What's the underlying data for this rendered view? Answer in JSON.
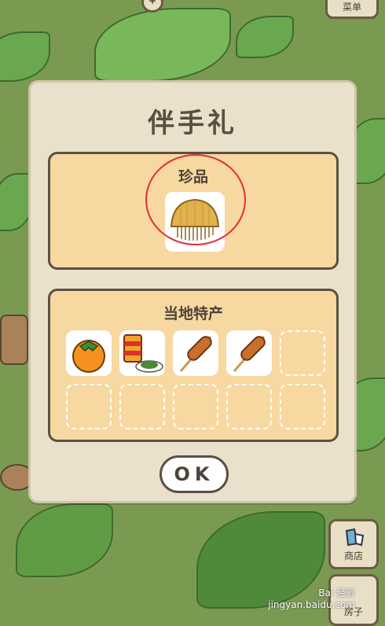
{
  "hud": {
    "menu_label": "菜单",
    "shop_label": "商店",
    "house_label": "房子"
  },
  "dialog": {
    "title": "伴手礼",
    "treasures": {
      "heading": "珍品",
      "items": [
        {
          "name": "comb",
          "icon": "comb-icon"
        }
      ]
    },
    "specialties": {
      "heading": "当地特产",
      "items": [
        {
          "name": "persimmon",
          "icon": "persimmon-icon"
        },
        {
          "name": "canned-food-and-greens",
          "icon": "can-and-plate-icon"
        },
        {
          "name": "grilled-skewer-1",
          "icon": "skewer-icon"
        },
        {
          "name": "grilled-skewer-2",
          "icon": "skewer-icon"
        },
        {
          "name": "",
          "icon": ""
        },
        {
          "name": "",
          "icon": ""
        },
        {
          "name": "",
          "icon": ""
        },
        {
          "name": "",
          "icon": ""
        },
        {
          "name": "",
          "icon": ""
        },
        {
          "name": "",
          "icon": ""
        }
      ]
    },
    "ok_label": "OK"
  },
  "watermark": {
    "line1": "Bai 经验",
    "line2": "jingyan.baidu.com"
  },
  "colors": {
    "panel": "#f7d8a0",
    "dialog": "#e9e1cc",
    "outline": "#5b5043",
    "highlight": "#e0303a"
  }
}
